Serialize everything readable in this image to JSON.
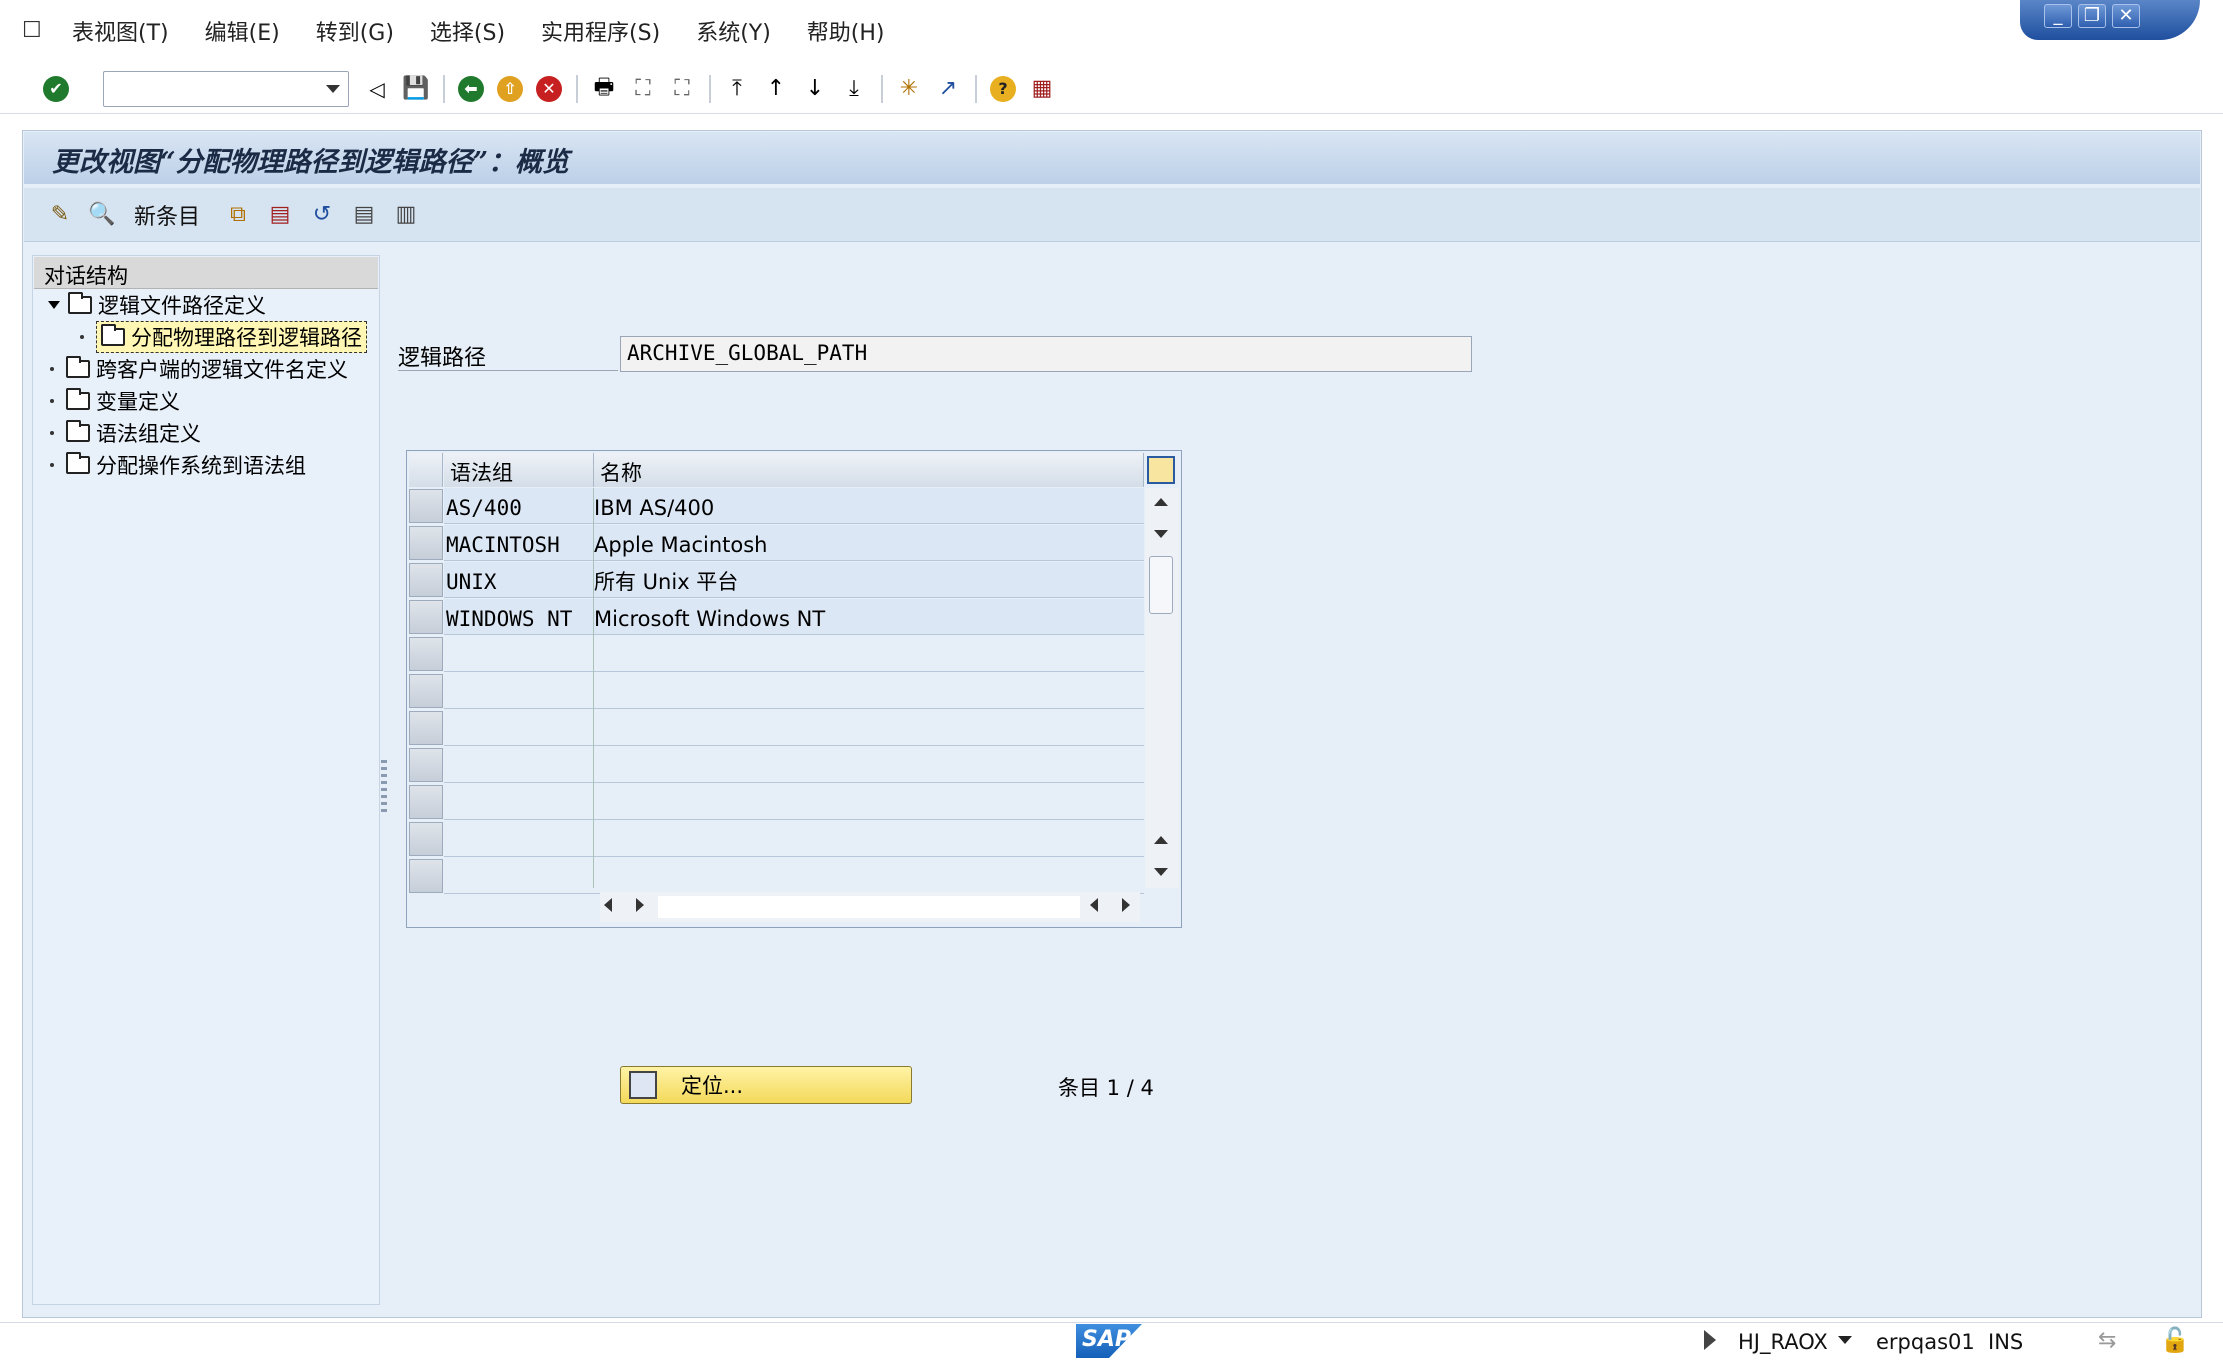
{
  "menubar": {
    "items": [
      "表视图(T)",
      "编辑(E)",
      "转到(G)",
      "选择(S)",
      "实用程序(S)",
      "系统(Y)",
      "帮助(H)"
    ]
  },
  "window_controls": {
    "minimize": "_",
    "restore": "❐",
    "close": "✕"
  },
  "toolbar": {
    "command_field": "",
    "icons": [
      "enter-check",
      "back",
      "save",
      "back-green",
      "exit",
      "cancel",
      "print",
      "find",
      "find-next",
      "first-page",
      "previous-page",
      "next-page",
      "last-page",
      "create-session",
      "shortcut",
      "help",
      "layout-menu"
    ]
  },
  "page": {
    "title": "更改视图“分配物理路径到逻辑路径”：概览"
  },
  "app_toolbar": {
    "new_entries": "新条目"
  },
  "dialog_structure": {
    "header": "对话结构",
    "items": [
      {
        "label": "逻辑文件路径定义",
        "expanded": true
      },
      {
        "label": "分配物理路径到逻辑路径",
        "selected": true
      },
      {
        "label": "跨客户端的逻辑文件名定义"
      },
      {
        "label": "变量定义"
      },
      {
        "label": "语法组定义"
      },
      {
        "label": "分配操作系统到语法组"
      }
    ]
  },
  "field": {
    "label": "逻辑路径",
    "value": "ARCHIVE_GLOBAL_PATH"
  },
  "table": {
    "columns": [
      "语法组",
      "名称"
    ],
    "rows": [
      {
        "syntax_group": "AS/400",
        "name": "IBM AS/400"
      },
      {
        "syntax_group": "MACINTOSH",
        "name": "Apple Macintosh"
      },
      {
        "syntax_group": "UNIX",
        "name": "所有 Unix 平台"
      },
      {
        "syntax_group": "WINDOWS NT",
        "name": "Microsoft Windows NT"
      }
    ]
  },
  "position_button": {
    "label": "定位..."
  },
  "entry_count": "条目 1 / 4",
  "status": {
    "logo": "SAP",
    "user": "HJ_RAOX",
    "server": "erpqas01",
    "mode": "INS"
  },
  "colors": {
    "accent_blue": "#1f4f9e",
    "frame_bg": "#e6eef7",
    "button_yellow": "#f3d95a"
  }
}
